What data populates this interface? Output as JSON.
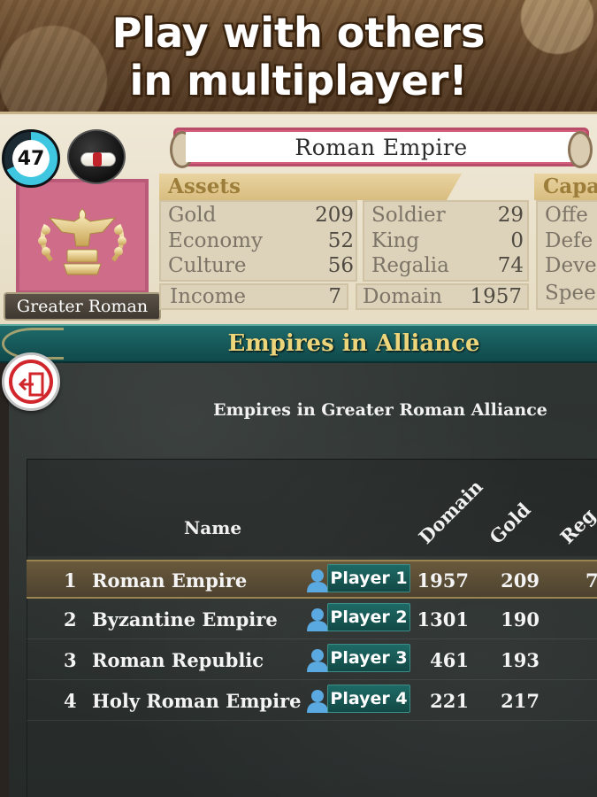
{
  "promo": {
    "line1": "Play with others",
    "line2": "in multiplayer!"
  },
  "header": {
    "turn_number": "47",
    "turn_progress_percent": 68,
    "empire_name": "Roman Empire",
    "alliance_label": "Greater Roman",
    "emblem_color": "#cf6c8a",
    "assets_tab": "Assets",
    "capacity_tab": "Capa",
    "assets": [
      {
        "label": "Gold",
        "value": "209"
      },
      {
        "label": "Economy",
        "value": "52"
      },
      {
        "label": "Culture",
        "value": "56"
      }
    ],
    "forces": [
      {
        "label": "Soldier",
        "value": "29"
      },
      {
        "label": "King",
        "value": "0"
      },
      {
        "label": "Regalia",
        "value": "74"
      }
    ],
    "income": {
      "label": "Income",
      "value": "7"
    },
    "domain": {
      "label": "Domain",
      "value": "1957"
    },
    "capacity_labels": [
      "Offe",
      "Defe",
      "Deve",
      "Spee"
    ]
  },
  "alliance": {
    "title": "Empires in Alliance",
    "subtitle": "Empires in Greater Roman Alliance",
    "columns": {
      "name": "Name",
      "domain": "Domain",
      "gold": "Gold",
      "regalia": "Reg"
    },
    "rows": [
      {
        "rank": "1",
        "name": "Roman Empire",
        "player": "Player 1",
        "domain": "1957",
        "gold": "209",
        "regalia": "7"
      },
      {
        "rank": "2",
        "name": "Byzantine Empire",
        "player": "Player 2",
        "domain": "1301",
        "gold": "190",
        "regalia": ""
      },
      {
        "rank": "3",
        "name": "Roman Republic",
        "player": "Player 3",
        "domain": "461",
        "gold": "193",
        "regalia": ""
      },
      {
        "rank": "4",
        "name": "Holy Roman Empire",
        "player": "Player 4",
        "domain": "221",
        "gold": "217",
        "regalia": ""
      }
    ]
  },
  "icons": {
    "turn": "turn-progress-ring",
    "scroll": "scroll-icon",
    "emblem": "eagle-standard-icon",
    "exit": "exit-door-icon",
    "player": "person-icon"
  },
  "colors": {
    "accent_gold": "#ecd57a",
    "header_teal": "#1f6b6b",
    "exit_red": "#d0262c",
    "turn_cyan": "#3fc6e0"
  }
}
